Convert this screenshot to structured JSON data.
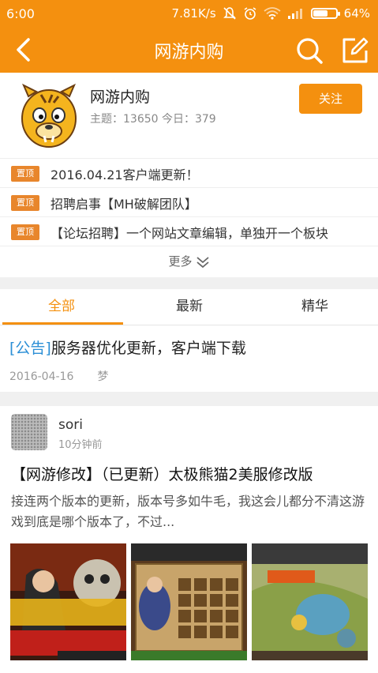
{
  "status_bar": {
    "time": "6:00",
    "network_speed": "7.81K/s",
    "battery_percent": "64%",
    "battery_level": 0.64
  },
  "header": {
    "title": "网游内购",
    "icons": [
      "back-arrow-icon",
      "search-icon",
      "edit-icon"
    ]
  },
  "forum": {
    "name": "网游内购",
    "stats": "主题：13650  今日：379",
    "follow_label": "关注"
  },
  "pinned": {
    "items": [
      {
        "tag": "置顶",
        "text": "2016.04.21客户端更新！"
      },
      {
        "tag": "置顶",
        "text": "招聘启事【MH破解团队】"
      },
      {
        "tag": "置顶",
        "text": "【论坛招聘】一个网站文章编辑，单独开一个板块"
      }
    ],
    "more_label": "更多"
  },
  "tabs": [
    {
      "label": "全部",
      "active": true
    },
    {
      "label": "最新",
      "active": false
    },
    {
      "label": "精华",
      "active": false
    }
  ],
  "posts": {
    "announcement": {
      "tag": "[公告]",
      "title": "服务器优化更新，客户端下载",
      "date": "2016-04-16",
      "author": "梦"
    },
    "user_post": {
      "username": "sori",
      "time": "10分钟前",
      "title": "【网游修改】（已更新）太极熊猫2美服修改版",
      "excerpt": "接连两个版本的更新，版本号多如牛毛，我这会儿都分不清这游戏到底是哪个版本了，不过..."
    }
  },
  "colors": {
    "accent": "#f4900f",
    "pin_tag": "#e8862c",
    "announcement_tag": "#2b8fd6"
  }
}
